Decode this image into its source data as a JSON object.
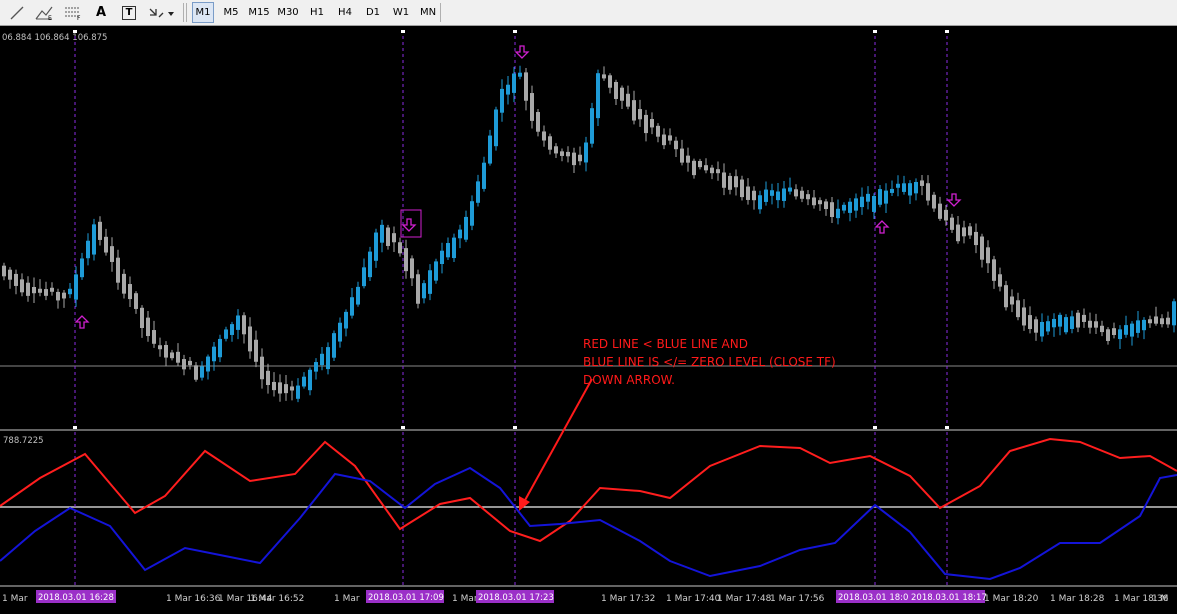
{
  "toolbar": {
    "tools": [
      {
        "icon": "line-tool-icon"
      },
      {
        "icon": "fibo-fan-icon"
      },
      {
        "icon": "fibo-retracement-icon"
      },
      {
        "icon": "text-tool-icon",
        "label": "A"
      },
      {
        "icon": "text-label-icon",
        "label": "T"
      },
      {
        "icon": "arrows-dropdown-icon"
      }
    ],
    "timeframes": [
      "M1",
      "M5",
      "M15",
      "M30",
      "H1",
      "H4",
      "D1",
      "W1",
      "MN"
    ],
    "active_timeframe": "M1"
  },
  "price_panel": {
    "header": "06.884 106.864 106.875"
  },
  "indicator_panel": {
    "header": "788.7225"
  },
  "annotation": {
    "line1": "RED LINE < BLUE LINE AND",
    "line2": "BLUE LINE IS </= ZERO LEVEL (CLOSE TF)",
    "line3": "DOWN ARROW.",
    "color": "#ff1a1a"
  },
  "time_axis": {
    "labels": [
      "1 Mar",
      "1 Mar 16:36",
      "1 Mar 16:44",
      "1 Mar 16:52",
      "1 Mar",
      "1 Mar",
      "1 Mar 17:32",
      "1 Mar 17:40",
      "1 Mar 17:48",
      "1 Mar 17:56",
      "1 Mar 18:20",
      "1 Mar 18:28",
      "1 Mar 18:36",
      "1 M"
    ],
    "highlight_labels": [
      "2018.03.01 16:28",
      "2018.03.01 17:09",
      "2018.03.01 17:23",
      "2018.03.01 18:0",
      "2018.03.01 18:17"
    ],
    "highlight_color": "#9b30c8"
  },
  "colors": {
    "bull_candle": "#1e9bd7",
    "bear_candle": "#a8a8a8",
    "red_line": "#ff1e1e",
    "blue_line": "#1414d8",
    "marker": "#d020d0",
    "vline": "#8a2be2"
  },
  "signals": {
    "up_arrows": 3,
    "down_arrows": 3
  }
}
